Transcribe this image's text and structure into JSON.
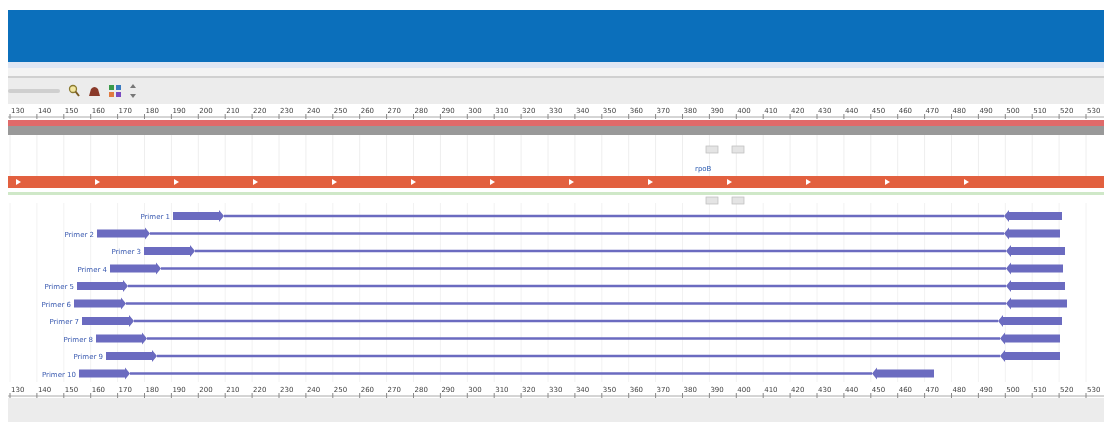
{
  "ruler_top": {
    "labels": [
      "130",
      "140",
      "150",
      "160",
      "170",
      "180",
      "190",
      "200",
      "210",
      "220",
      "230",
      "240",
      "250",
      "260",
      "270",
      "280",
      "290",
      "300",
      "310",
      "320",
      "330",
      "340",
      "350",
      "360",
      "370",
      "380",
      "390",
      "400",
      "410",
      "420",
      "430",
      "440",
      "450",
      "460",
      "470",
      "480",
      "490",
      "500",
      "510",
      "520",
      "530"
    ]
  },
  "annotation": {
    "label": "rpoB"
  },
  "primers": [
    {
      "name": "Primer 1"
    },
    {
      "name": "Primer 2"
    },
    {
      "name": "Primer 3"
    },
    {
      "name": "Primer 4"
    },
    {
      "name": "Primer 5"
    },
    {
      "name": "Primer 6"
    },
    {
      "name": "Primer 7"
    },
    {
      "name": "Primer 8"
    },
    {
      "name": "Primer 9"
    },
    {
      "name": "Primer 10"
    }
  ],
  "ruler_bottom": {
    "labels": [
      "130",
      "140",
      "150",
      "160",
      "170",
      "180",
      "190",
      "200",
      "210",
      "220",
      "230",
      "240",
      "250",
      "260",
      "270",
      "280",
      "290",
      "300",
      "310",
      "320",
      "330",
      "340",
      "350",
      "360",
      "370",
      "380",
      "390",
      "400",
      "410",
      "420",
      "430",
      "440",
      "450",
      "460",
      "470",
      "480",
      "490",
      "500",
      "510",
      "520",
      "530"
    ]
  }
}
